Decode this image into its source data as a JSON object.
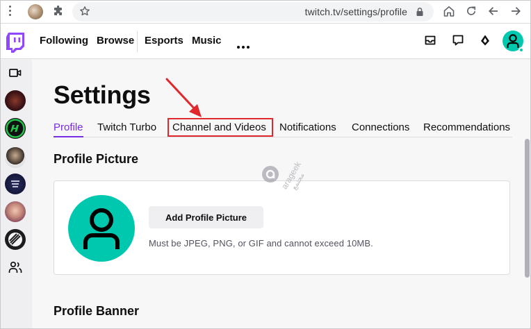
{
  "browser": {
    "url": "twitch.tv/settings/profile"
  },
  "topnav": {
    "links": [
      "Following",
      "Browse",
      "Esports",
      "Music"
    ]
  },
  "settings": {
    "title": "Settings",
    "tabs": [
      {
        "label": "Profile",
        "active": true
      },
      {
        "label": "Twitch Turbo",
        "active": false
      },
      {
        "label": "Channel and Videos",
        "active": false,
        "highlighted": true
      },
      {
        "label": "Notifications",
        "active": false
      },
      {
        "label": "Connections",
        "active": false
      },
      {
        "label": "Recommendations",
        "active": false
      }
    ],
    "profile_picture": {
      "heading": "Profile Picture",
      "button_label": "Add Profile Picture",
      "hint": "Must be JPEG, PNG, or GIF and cannot exceed 10MB."
    },
    "profile_banner": {
      "heading": "Profile Banner"
    }
  },
  "watermark": {
    "latin": "arageek",
    "arabic": "مجتمع"
  },
  "colors": {
    "accent": "#772ce8",
    "brand": "#9146ff",
    "avatar": "#00c8af",
    "highlight": "#e0272b"
  },
  "icons": {
    "sidebar": [
      "camera-icon",
      "people-icon"
    ],
    "topnav": [
      "inbox-icon",
      "whispers-icon",
      "bits-icon"
    ]
  }
}
